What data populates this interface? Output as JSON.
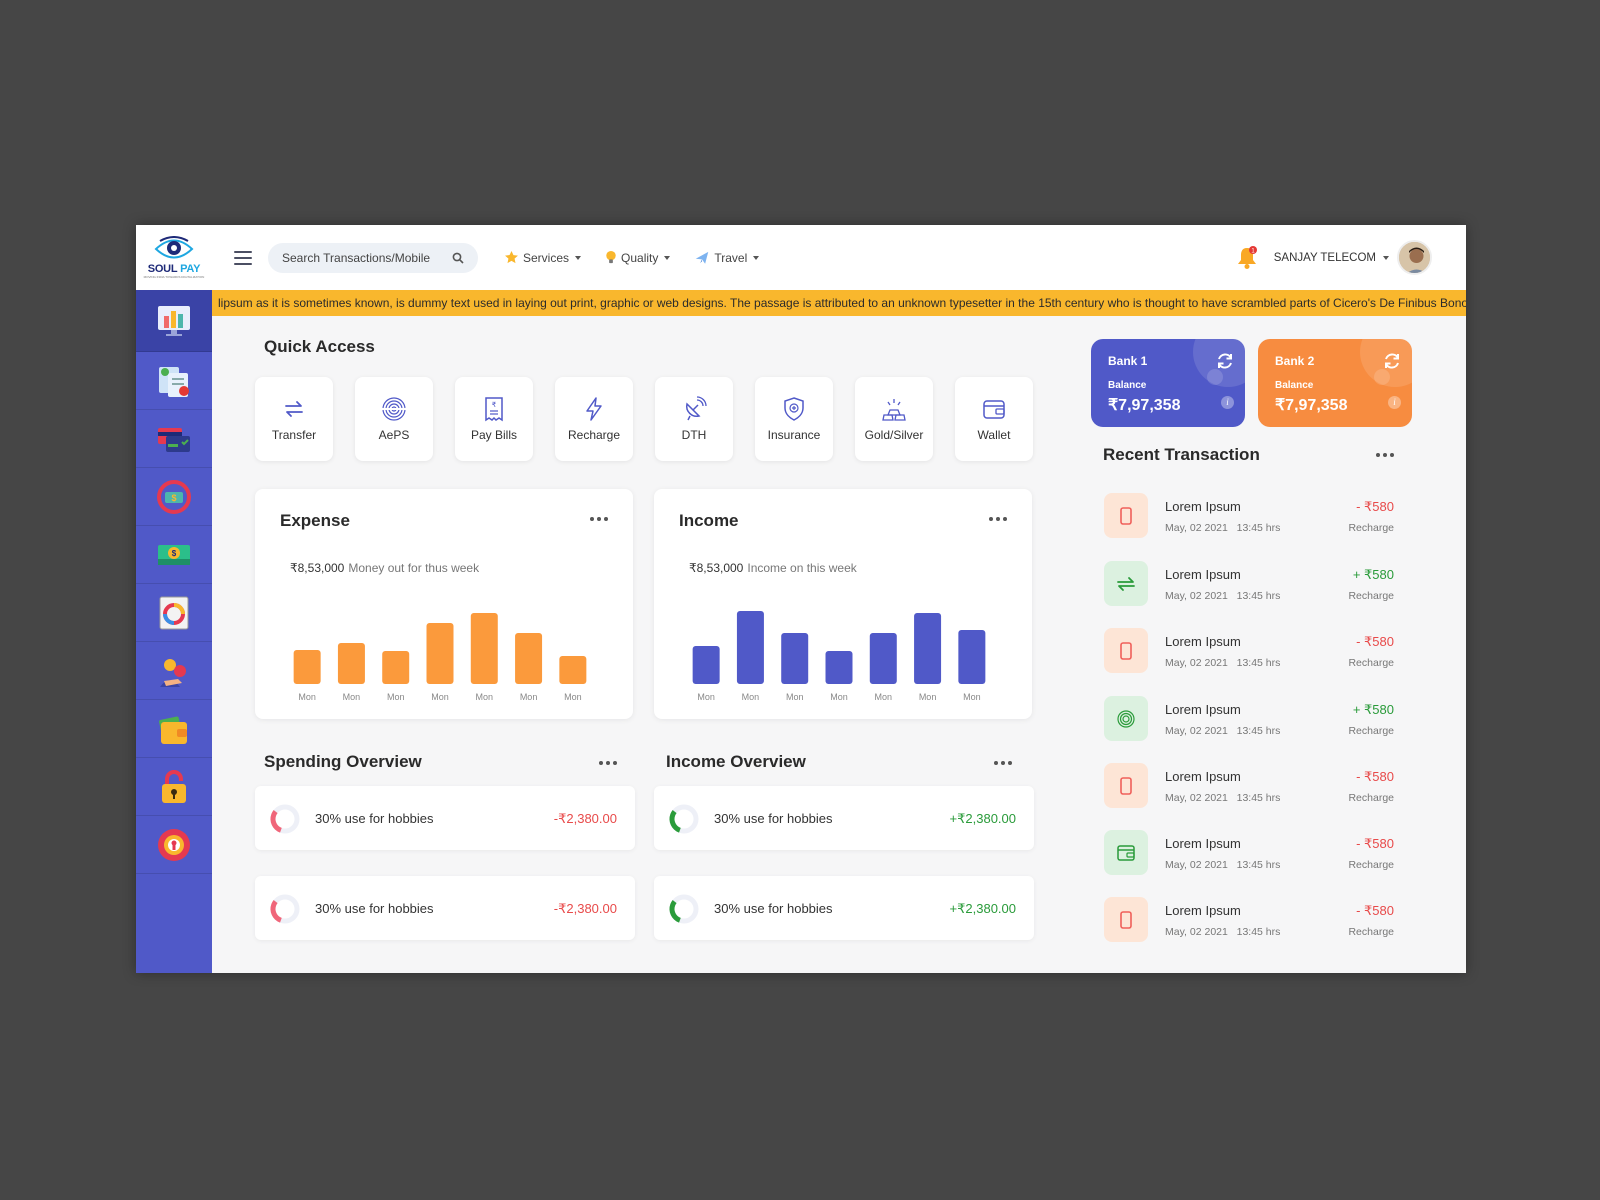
{
  "logo": {
    "text_a": "SOUL",
    "text_b": " PAY",
    "tagline": "MOVING INDIA TOWARDS DIGITALIZATION"
  },
  "search": {
    "placeholder": "Search Transactions/Mobile"
  },
  "nav": [
    {
      "label": "Services",
      "icon": "star-icon"
    },
    {
      "label": "Quality",
      "icon": "bulb-icon"
    },
    {
      "label": "Travel",
      "icon": "plane-icon"
    }
  ],
  "user": {
    "name": "SANJAY TELECOM",
    "notifications": "1"
  },
  "ticker": "lipsum as it is sometimes known, is dummy text used in laying out print, graphic or web designs. The passage is attributed to an unknown typesetter in the 15th century who is thought to have scrambled parts of Cicero's De Finibus Bonorum et Malorum for use in a type specimen book.",
  "sidebar": [
    "dashboard-icon",
    "forms-icon",
    "cards-icon",
    "money-transfer-icon",
    "cash-icon",
    "report-icon",
    "users-icon",
    "wallet-icon",
    "lock-icon",
    "support-icon"
  ],
  "quick_access": {
    "title": "Quick Access",
    "items": [
      {
        "label": "Transfer",
        "icon": "transfer-icon"
      },
      {
        "label": "AePS",
        "icon": "fingerprint-icon"
      },
      {
        "label": "Pay Bills",
        "icon": "bill-icon"
      },
      {
        "label": "Recharge",
        "icon": "lightning-icon"
      },
      {
        "label": "DTH",
        "icon": "satellite-dish-icon"
      },
      {
        "label": "Insurance",
        "icon": "shield-icon"
      },
      {
        "label": "Gold/Silver",
        "icon": "gold-bars-icon"
      },
      {
        "label": "Wallet",
        "icon": "wallet-icon"
      }
    ]
  },
  "expense": {
    "title": "Expense",
    "amount": "₹8,53,000",
    "caption": "Money out for thus week"
  },
  "income": {
    "title": "Income",
    "amount": "₹8,53,000",
    "caption": "Income on this week"
  },
  "chart_data": [
    {
      "type": "bar",
      "title": "Expense",
      "categories": [
        "Mon",
        "Mon",
        "Mon",
        "Mon",
        "Mon",
        "Mon",
        "Mon"
      ],
      "values": [
        34,
        41,
        33,
        61,
        71,
        51,
        28
      ],
      "color": "#fb9a3c",
      "ylim": [
        0,
        80
      ]
    },
    {
      "type": "bar",
      "title": "Income",
      "categories": [
        "Mon",
        "Mon",
        "Mon",
        "Mon",
        "Mon",
        "Mon",
        "Mon"
      ],
      "values": [
        38,
        73,
        51,
        33,
        51,
        71,
        54
      ],
      "color": "#5059c8",
      "ylim": [
        0,
        80
      ]
    }
  ],
  "spending_overview": {
    "title": "Spending Overview",
    "items": [
      {
        "text": "30% use for hobbies",
        "amount": "-₹2,380.00",
        "percent": 30,
        "color": "#f0667a"
      },
      {
        "text": "30% use for hobbies",
        "amount": "-₹2,380.00",
        "percent": 30,
        "color": "#f0667a"
      }
    ]
  },
  "income_overview": {
    "title": "Income Overview",
    "items": [
      {
        "text": "30% use for hobbies",
        "amount": "+₹2,380.00",
        "percent": 30,
        "color": "#2a9b3a"
      },
      {
        "text": "30% use for hobbies",
        "amount": "+₹2,380.00",
        "percent": 30,
        "color": "#2a9b3a"
      }
    ]
  },
  "banks": [
    {
      "name": "Bank 1",
      "balance_label": "Balance",
      "amount": "₹7,97,358",
      "color": "#5059c8"
    },
    {
      "name": "Bank 2",
      "balance_label": "Balance",
      "amount": "₹7,97,358",
      "color": "#f78c40"
    }
  ],
  "recent": {
    "title": "Recent Transaction",
    "items": [
      {
        "title": "Lorem Ipsum",
        "date": "May, 02 2021   13:45 hrs",
        "amount": "- ₹580",
        "type": "Recharge",
        "icon": "mobile-icon",
        "sign": "neg"
      },
      {
        "title": "Lorem Ipsum",
        "date": "May, 02 2021   13:45 hrs",
        "amount": "+ ₹580",
        "type": "Recharge",
        "icon": "transfer-icon",
        "sign": "pos"
      },
      {
        "title": "Lorem Ipsum",
        "date": "May, 02 2021   13:45 hrs",
        "amount": "- ₹580",
        "type": "Recharge",
        "icon": "mobile-icon",
        "sign": "neg"
      },
      {
        "title": "Lorem Ipsum",
        "date": "May, 02 2021   13:45 hrs",
        "amount": "+ ₹580",
        "type": "Recharge",
        "icon": "fingerprint-icon",
        "sign": "pos"
      },
      {
        "title": "Lorem Ipsum",
        "date": "May, 02 2021   13:45 hrs",
        "amount": "- ₹580",
        "type": "Recharge",
        "icon": "mobile-icon",
        "sign": "neg"
      },
      {
        "title": "Lorem Ipsum",
        "date": "May, 02 2021   13:45 hrs",
        "amount": "- ₹580",
        "type": "Recharge",
        "icon": "wallet-icon",
        "sign": "neg"
      },
      {
        "title": "Lorem Ipsum",
        "date": "May, 02 2021   13:45 hrs",
        "amount": "- ₹580",
        "type": "Recharge",
        "icon": "mobile-icon",
        "sign": "neg"
      }
    ]
  }
}
